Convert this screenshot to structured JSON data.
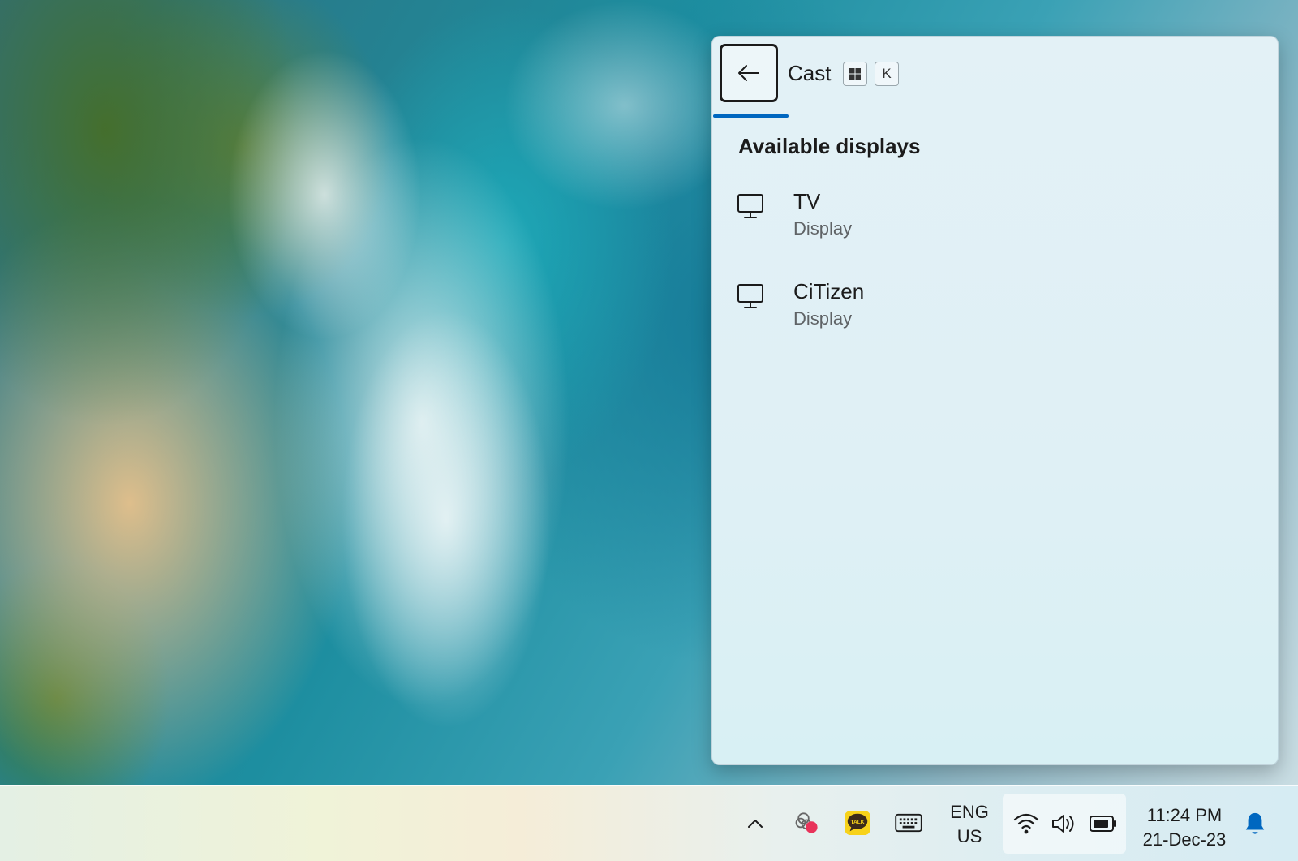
{
  "cast_panel": {
    "title": "Cast",
    "shortcut_keys": [
      "⊞",
      "K"
    ],
    "section_title": "Available displays",
    "devices": [
      {
        "name": "TV",
        "type": "Display"
      },
      {
        "name": "CiTizen",
        "type": "Display"
      }
    ],
    "accent_color": "#0067c0"
  },
  "taskbar": {
    "language": {
      "line1": "ENG",
      "line2": "US"
    },
    "time": "11:24 PM",
    "date": "21-Dec-23",
    "tray_icons": [
      "chevron-up-icon",
      "app-icon",
      "kakaotalk-icon",
      "touch-keyboard-icon",
      "wifi-icon",
      "volume-icon",
      "battery-icon",
      "notification-bell-icon"
    ],
    "talk_badge": "TALK"
  }
}
